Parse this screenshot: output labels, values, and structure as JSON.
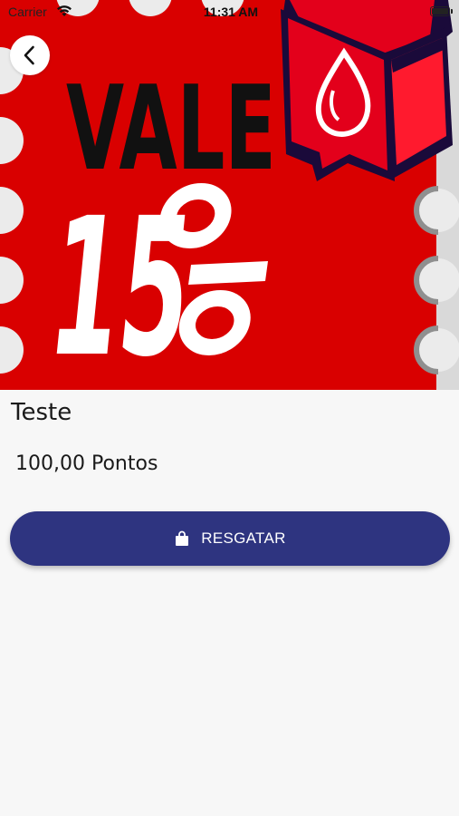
{
  "status_bar": {
    "carrier": "Carrier",
    "time": "11:31 AM",
    "wifi_icon": "wifi-icon",
    "battery_icon": "battery-icon"
  },
  "hero": {
    "alt": "VALE 15%",
    "line1": "VALE",
    "line2_digits": "15",
    "background_color": "#d90000",
    "accent_color": "#ff1a2e"
  },
  "navigation": {
    "back_icon": "chevron-left-icon"
  },
  "product": {
    "title": "Teste",
    "points": "100,00 Pontos"
  },
  "actions": {
    "redeem_label": "RESGATAR",
    "redeem_icon": "shopping-bag-icon",
    "redeem_color": "#2e3480"
  }
}
